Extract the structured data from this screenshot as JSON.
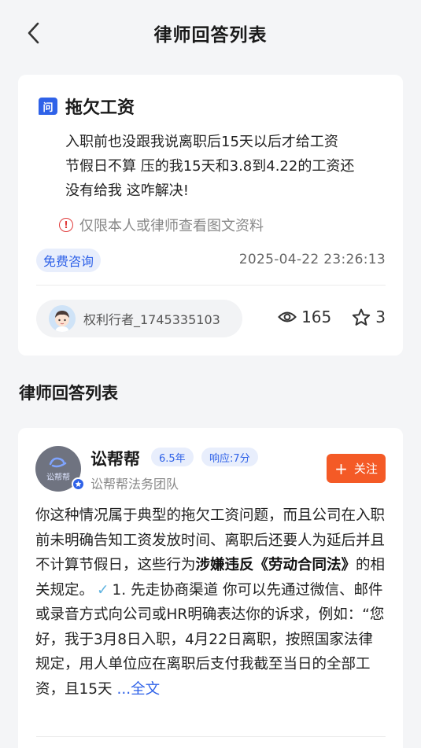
{
  "header": {
    "title": "律师回答列表"
  },
  "question": {
    "icon_label": "问",
    "title": "拖欠工资",
    "body_lines": [
      "入职前也没跟我说离职后15天以后才给工资",
      "节假日不算 压的我15天和3.8到4.22的工资还",
      "没有给我 这咋解决!"
    ],
    "restrict_text": "仅限本人或律师查看图文资料",
    "badge": "免费咨询",
    "time": "2025-04-22 23:26:13",
    "user_name": "权利行者_1745335103",
    "views": "165",
    "stars": "3"
  },
  "section": {
    "title": "律师回答列表"
  },
  "answer": {
    "avatar_text": "讼帮帮",
    "name": "讼帮帮",
    "tag_years": "6.5年",
    "tag_response": "响应:7分",
    "team": "讼帮帮法务团队",
    "follow_label": "关注",
    "body_part1": "你这种情况属于典型的拖欠工资问题，而且公司在入职前未明确告知工资发放时间、离职后还要人为延后并且不计算节假日，这些行为",
    "body_bold": "涉嫌违反《劳动合同法》",
    "body_part2": "的相关规定。",
    "body_part3": "1. 先走协商渠道 你可以先通过微信、邮件或录音方式向公司或HR明确表达你的诉求，例如：“您好，我于3月8日入职，4月22日离职，按照国家法律规定，用人单位应在离职后支付我截至当日的全部工资，且15天",
    "more_label": "...全文"
  }
}
